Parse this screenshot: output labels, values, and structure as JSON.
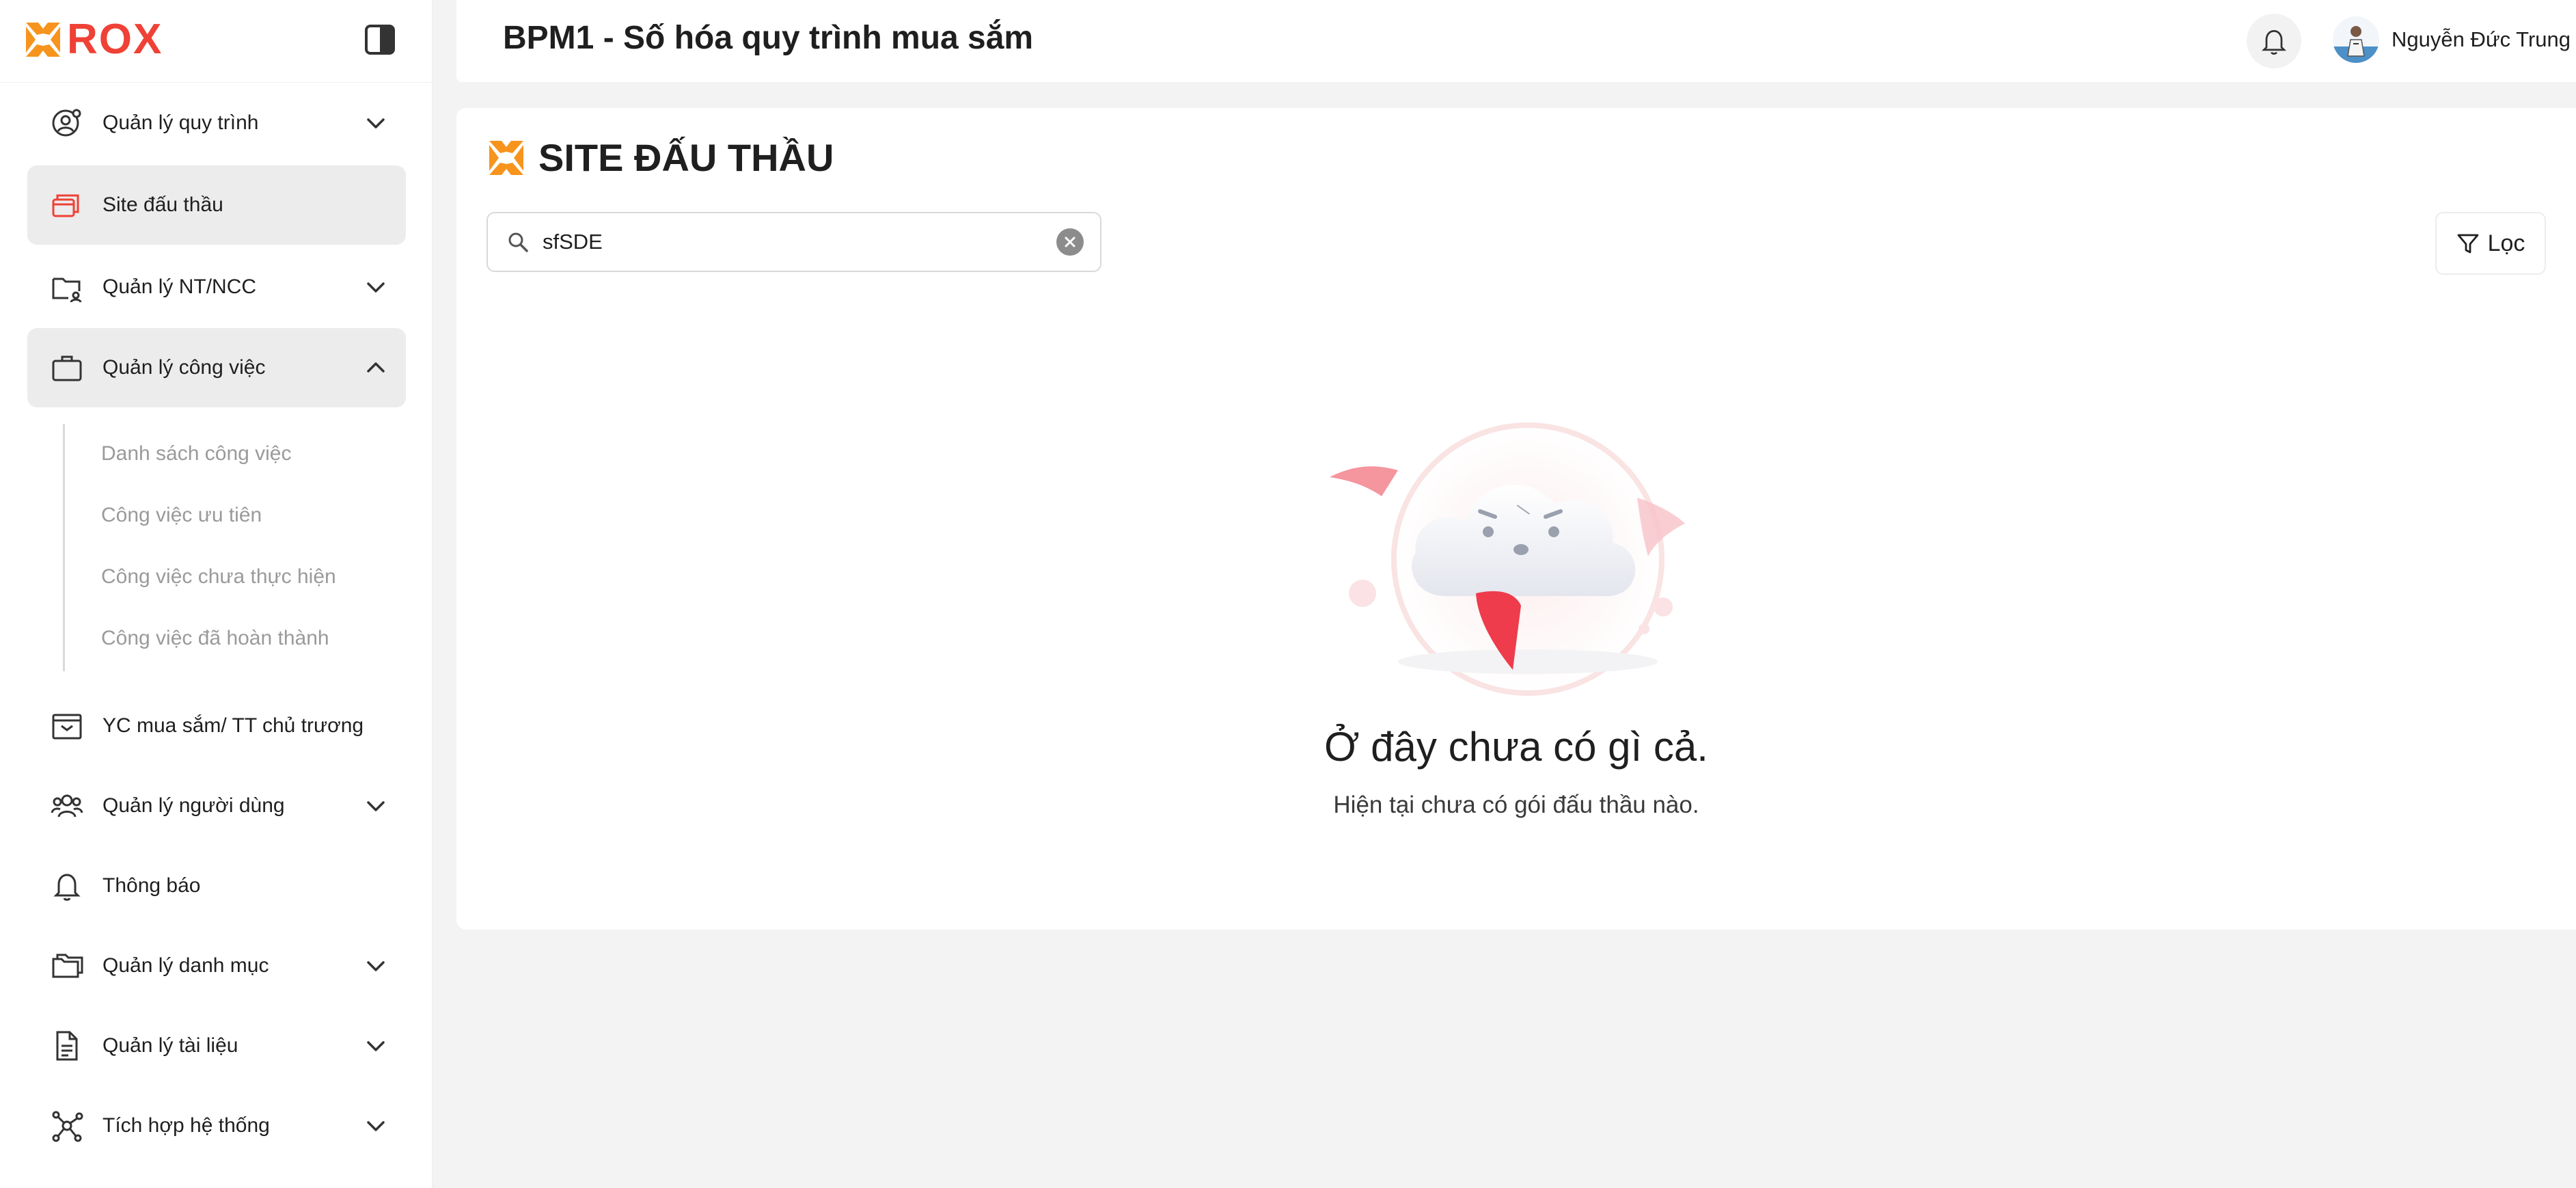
{
  "brand": {
    "name": "ROX",
    "accent": "#ef4136",
    "logo_accent": "#f7941d"
  },
  "header": {
    "title": "BPM1 - Số hóa quy trình mua sắm",
    "user_name": "Nguyễn Đức Trung"
  },
  "sidebar": {
    "items": [
      {
        "label": "Quản lý quy trình",
        "icon": "user-settings-icon",
        "chevron": "down"
      },
      {
        "label": "Site đấu thầu",
        "icon": "cards-icon",
        "active": true
      },
      {
        "label": "Quản lý NT/NCC",
        "icon": "folder-user-icon",
        "chevron": "down"
      },
      {
        "label": "Quản lý công việc",
        "icon": "briefcase-icon",
        "chevron": "up",
        "expanded": true
      },
      {
        "label": "YC mua sắm/ TT chủ trương",
        "icon": "inbox-icon"
      },
      {
        "label": "Quản lý người dùng",
        "icon": "users-icon",
        "chevron": "down"
      },
      {
        "label": "Thông báo",
        "icon": "bell-icon"
      },
      {
        "label": "Quản lý danh mục",
        "icon": "folders-icon",
        "chevron": "down"
      },
      {
        "label": "Quản lý tài liệu",
        "icon": "document-icon",
        "chevron": "down"
      },
      {
        "label": "Tích hợp hệ thống",
        "icon": "network-icon",
        "chevron": "down"
      }
    ],
    "subitems": [
      "Danh sách công việc",
      "Công việc ưu tiên",
      "Công việc chưa thực hiện",
      "Công việc đã hoàn thành"
    ]
  },
  "main": {
    "section_title": "SITE ĐẤU THẦU",
    "search": {
      "value": "sfSDE",
      "placeholder": ""
    },
    "filter_label": "Lọc",
    "empty": {
      "title": "Ở đây chưa có gì cả.",
      "subtitle": "Hiện tại chưa có gói đấu thầu nào."
    }
  }
}
